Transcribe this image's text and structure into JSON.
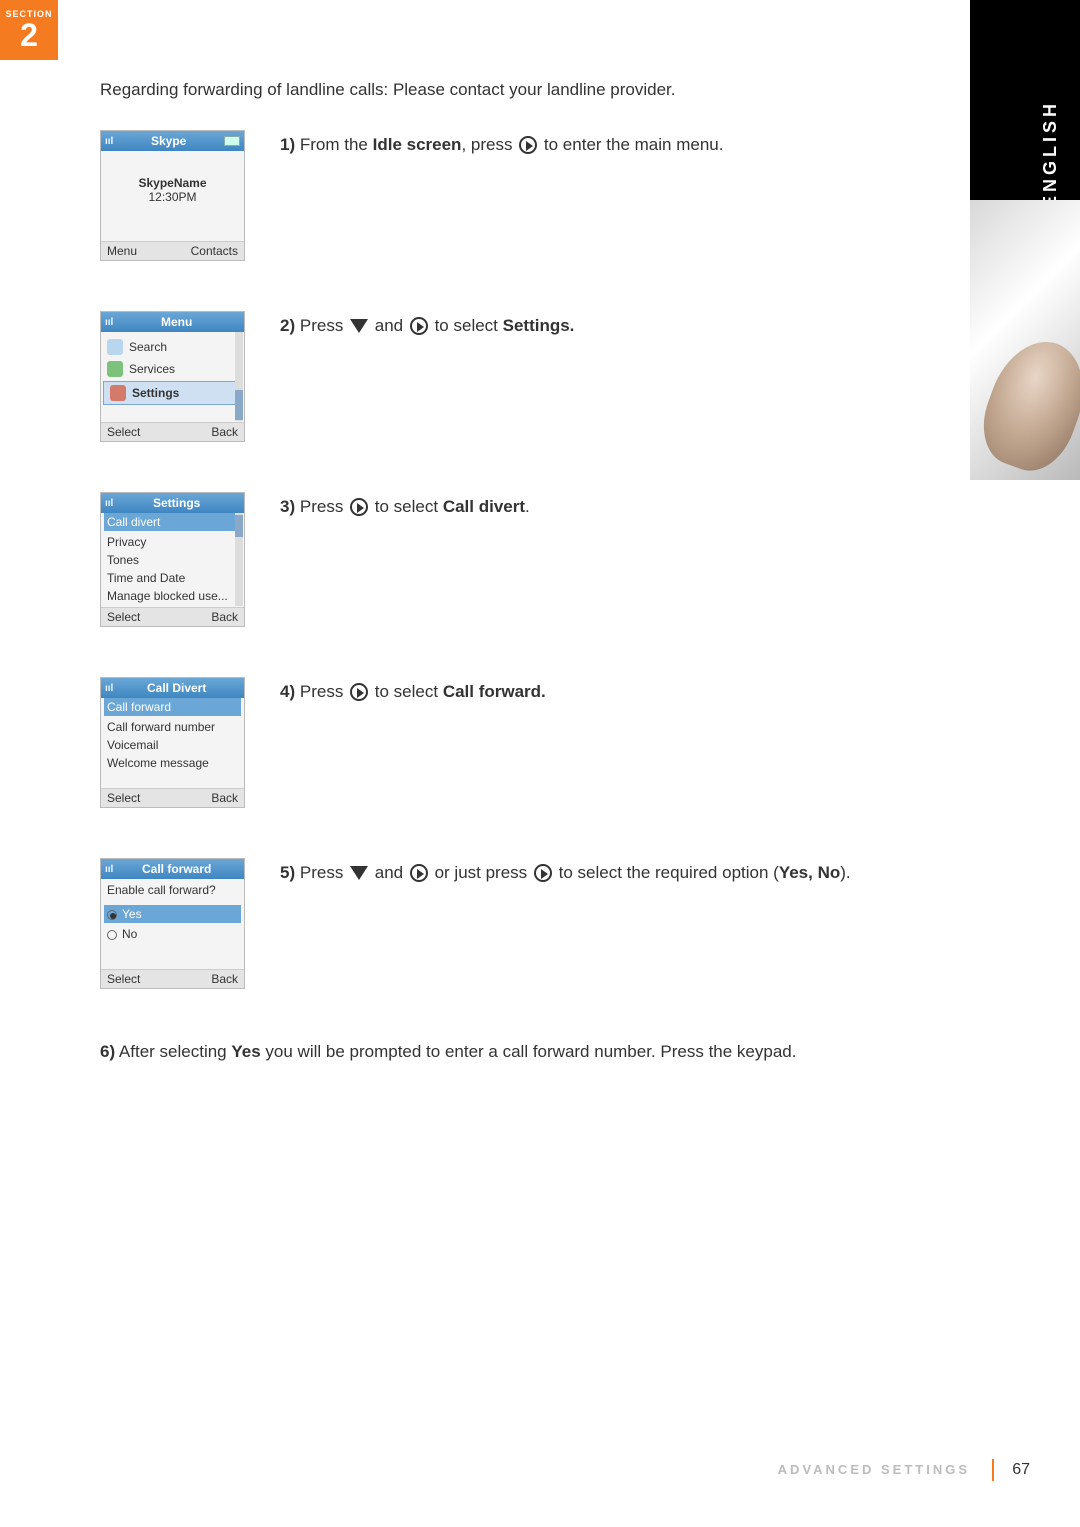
{
  "section": {
    "label": "SECTION",
    "number": "2"
  },
  "language": "ENGLISH",
  "intro": "Regarding forwarding of landline calls: Please contact your landline provider.",
  "lcd1": {
    "title": "Skype",
    "name": "SkypeName",
    "time": "12:30PM",
    "softLeft": "Menu",
    "softRight": "Contacts"
  },
  "lcd2": {
    "title": "Menu",
    "items": [
      "Search",
      "Services",
      "Settings"
    ],
    "softLeft": "Select",
    "softRight": "Back"
  },
  "lcd3": {
    "title": "Settings",
    "items": [
      "Call divert",
      "Privacy",
      "Tones",
      "Time and Date",
      "Manage blocked use..."
    ],
    "softLeft": "Select",
    "softRight": "Back"
  },
  "lcd4": {
    "title": "Call Divert",
    "items": [
      "Call forward",
      "Call forward number",
      "Voicemail",
      "Welcome message"
    ],
    "softLeft": "Select",
    "softRight": "Back"
  },
  "lcd5": {
    "title": "Call forward",
    "prompt": "Enable call forward?",
    "opts": [
      "Yes",
      "No"
    ],
    "softLeft": "Select",
    "softRight": "Back"
  },
  "step1": {
    "num": "1)",
    "a": "From the ",
    "b": "Idle screen",
    "c": ", press ",
    "d": " to enter the main menu."
  },
  "step2": {
    "num": "2)",
    "a": "Press ",
    "b": " and ",
    "c": " to select ",
    "d": "Settings."
  },
  "step3": {
    "num": "3)",
    "a": "Press ",
    "b": " to select ",
    "c": "Call divert",
    "d": "."
  },
  "step4": {
    "num": "4)",
    "a": "Press ",
    "b": " to select ",
    "c": "Call forward."
  },
  "step5": {
    "num": "5)",
    "a": "Press ",
    "b": " and ",
    "c": " or just press ",
    "d": " to select the required option (",
    "e": "Yes, No",
    "f": ")."
  },
  "step6": {
    "num": "6)",
    "a": "After selecting ",
    "b": "Yes",
    "c": " you will be prompted to enter a call forward number. Press the keypad."
  },
  "footer": "ADVANCED SETTINGS",
  "page": "67"
}
